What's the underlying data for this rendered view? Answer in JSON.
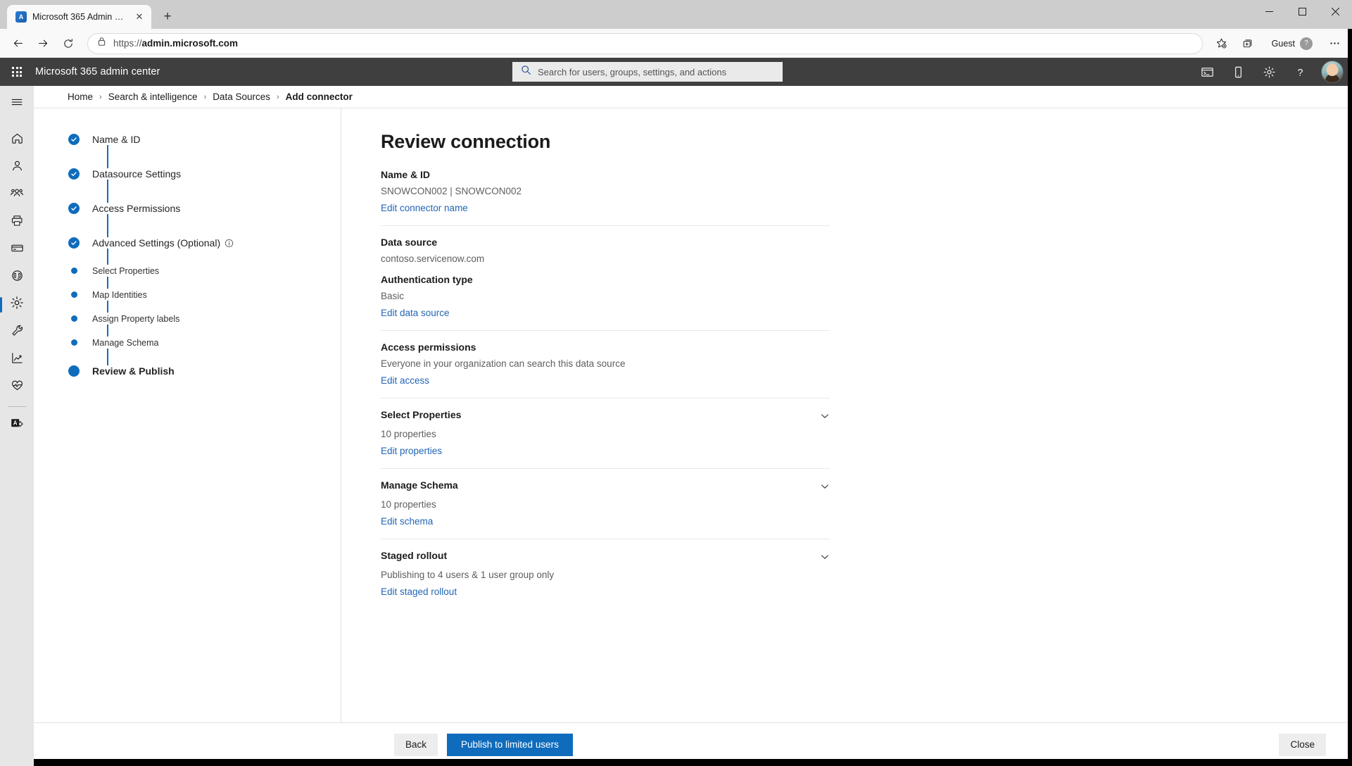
{
  "browser": {
    "tab": {
      "title": "Microsoft 365 Admin Center",
      "favicon": "m365-admin-favicon",
      "close": "✕"
    },
    "new_tab": "+",
    "url_prefix": "https://",
    "url_domain": "admin.microsoft.com",
    "profile_label": "Guest",
    "window_controls": {
      "minimize": "minimize-icon",
      "maximize": "maximize-icon",
      "close": "close-icon"
    },
    "toolbar_icons": [
      "back-icon",
      "forward-icon",
      "refresh-icon",
      "lock-icon",
      "favorite-icon",
      "collections-icon",
      "settings-more-icon"
    ]
  },
  "suitebar": {
    "waffle": "app-launcher-icon",
    "title": "Microsoft 365 admin center",
    "search": {
      "placeholder": "Search for users, groups, settings, and actions",
      "value": ""
    },
    "icons": [
      "console-icon",
      "mobile-device-icon",
      "gear-icon",
      "help-icon"
    ],
    "avatar": "user-avatar"
  },
  "rail": {
    "items": [
      {
        "name": "hamburger-menu",
        "icon": "hamburger-icon",
        "active": false
      },
      {
        "name": "home",
        "icon": "home-icon",
        "active": false
      },
      {
        "name": "users",
        "icon": "user-icon",
        "active": false
      },
      {
        "name": "teams-groups",
        "icon": "people-icon",
        "active": false
      },
      {
        "name": "devices",
        "icon": "printer-icon",
        "active": false
      },
      {
        "name": "billing",
        "icon": "credit-card-icon",
        "active": false
      },
      {
        "name": "support",
        "icon": "headset-icon",
        "active": false
      },
      {
        "name": "settings",
        "icon": "gear-icon",
        "active": true
      },
      {
        "name": "setup",
        "icon": "wrench-icon",
        "active": false
      },
      {
        "name": "reports",
        "icon": "chart-line-icon",
        "active": false
      },
      {
        "name": "health",
        "icon": "heart-pulse-icon",
        "active": false
      },
      {
        "name": "admin-centers",
        "icon": "admin-app-icon",
        "active": false
      }
    ]
  },
  "breadcrumb": {
    "items": [
      "Home",
      "Search & intelligence",
      "Data Sources"
    ],
    "separator": "›",
    "current": "Add connector"
  },
  "wizard": {
    "steps": [
      {
        "label": "Name & ID",
        "state": "complete",
        "type": "main"
      },
      {
        "label": "Datasource Settings",
        "state": "complete",
        "type": "main"
      },
      {
        "label": "Access Permissions",
        "state": "complete",
        "type": "main"
      },
      {
        "label": "Advanced Settings (Optional)",
        "state": "complete",
        "type": "main",
        "info": "info-icon"
      },
      {
        "label": "Select Properties",
        "state": "done",
        "type": "sub"
      },
      {
        "label": "Map Identities",
        "state": "done",
        "type": "sub"
      },
      {
        "label": "Assign Property labels",
        "state": "done",
        "type": "sub"
      },
      {
        "label": "Manage Schema",
        "state": "done",
        "type": "sub"
      },
      {
        "label": "Review & Publish",
        "state": "current",
        "type": "main"
      }
    ]
  },
  "panel": {
    "title": "Review connection",
    "sections": [
      {
        "title": "Name & ID",
        "value": "SNOWCON002 | SNOWCON002",
        "link": "Edit connector name",
        "collapsible": false
      },
      {
        "title": "Data source",
        "value": "contoso.servicenow.com",
        "sub_title": "Authentication type",
        "sub_value": "Basic",
        "link": "Edit data source",
        "collapsible": false
      },
      {
        "title": "Access permissions",
        "value": "Everyone in your organization can search this data source",
        "link": "Edit access",
        "collapsible": false
      },
      {
        "title": "Select Properties",
        "value": "10 properties",
        "link": "Edit properties",
        "collapsible": true
      },
      {
        "title": "Manage Schema",
        "value": "10 properties",
        "link": "Edit schema",
        "collapsible": true
      },
      {
        "title": "Staged rollout",
        "value": "Publishing to 4 users & 1 user group only",
        "link": "Edit staged rollout",
        "collapsible": true
      }
    ]
  },
  "footer": {
    "back_label": "Back",
    "publish_label": "Publish to limited users",
    "close_label": "Close"
  },
  "colors": {
    "accent": "#0f6cbd",
    "link": "#2266b5",
    "suitebar_bg": "#3f3f3f",
    "rail_bg": "#e6e6e6"
  }
}
